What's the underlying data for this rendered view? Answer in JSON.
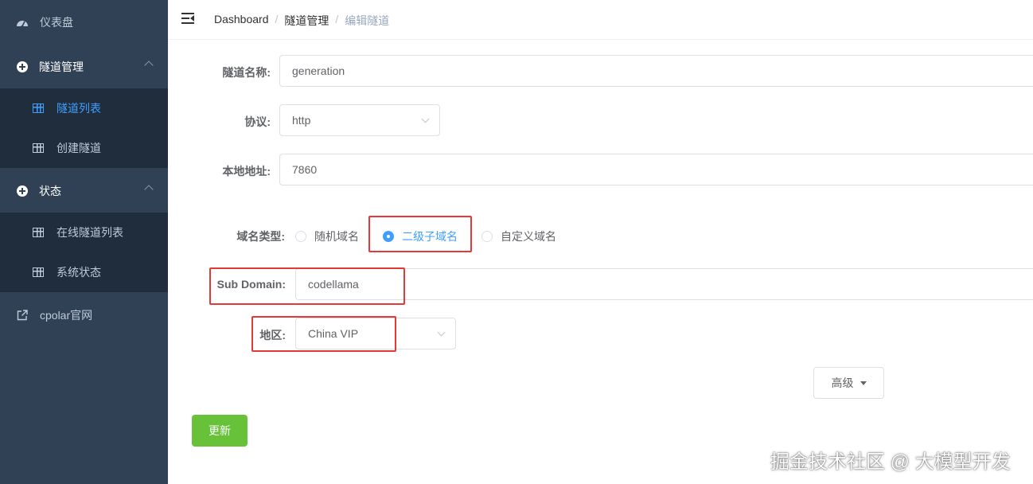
{
  "sidebar": {
    "dashboard": {
      "label": "仪表盘",
      "icon": "dashboard-icon"
    },
    "tunnel_group": {
      "label": "隧道管理",
      "icon": "circle-plus-icon"
    },
    "tunnel_list": {
      "label": "隧道列表",
      "icon": "grid-icon"
    },
    "create_tunnel": {
      "label": "创建隧道",
      "icon": "grid-icon"
    },
    "status_group": {
      "label": "状态",
      "icon": "circle-plus-icon"
    },
    "online_list": {
      "label": "在线隧道列表",
      "icon": "grid-icon"
    },
    "system_status": {
      "label": "系统状态",
      "icon": "grid-icon"
    },
    "website": {
      "label": "cpolar官网",
      "icon": "external-link-icon"
    }
  },
  "breadcrumb": [
    "Dashboard",
    "隧道管理",
    "编辑隧道"
  ],
  "form": {
    "name_label": "隧道名称:",
    "name_value": "generation",
    "protocol_label": "协议:",
    "protocol_value": "http",
    "local_label": "本地地址:",
    "local_value": "7860",
    "domain_type_label": "域名类型:",
    "domain_types": [
      "随机域名",
      "二级子域名",
      "自定义域名"
    ],
    "domain_type_selected": "二级子域名",
    "subdomain_label": "Sub Domain:",
    "subdomain_value": "codellama",
    "region_label": "地区:",
    "region_value": "China VIP",
    "advanced_label": "高级",
    "update_label": "更新"
  },
  "watermark": "掘金技术社区 @ 大模型开发",
  "colors": {
    "sidebar": "#304156",
    "submenu": "#1f2d3d",
    "active": "#409eff",
    "update": "#67c23a",
    "highlight": "#e53935"
  }
}
